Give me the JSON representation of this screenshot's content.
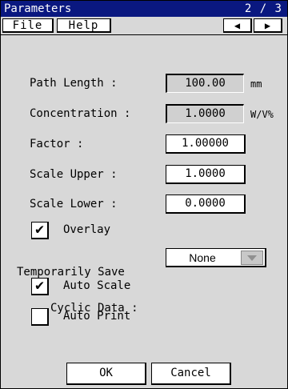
{
  "window": {
    "title": "Parameters",
    "page_indicator": "2 / 3"
  },
  "menu": {
    "file": "File",
    "help": "Help",
    "prev_icon": "left-arrow",
    "next_icon": "right-arrow"
  },
  "fields": {
    "path_length": {
      "label": "Path Length :",
      "value": "100.00",
      "unit": "mm"
    },
    "concentration": {
      "label": "Concentration :",
      "value": "1.0000",
      "unit": "W/V%"
    },
    "factor": {
      "label": "Factor :",
      "value": "1.00000"
    },
    "scale_upper": {
      "label": "Scale Upper :",
      "value": "1.0000"
    },
    "scale_lower": {
      "label": "Scale Lower :",
      "value": "0.0000"
    }
  },
  "checkboxes": {
    "overlay": {
      "label": "Overlay",
      "checked": true
    },
    "auto_scale": {
      "label": "Auto Scale",
      "checked": true
    },
    "auto_print": {
      "label": "Auto Print",
      "checked": false
    }
  },
  "cyclic": {
    "label_line1": "Temporarily Save",
    "label_line2": "Cyclic Data :",
    "selected": "None"
  },
  "buttons": {
    "ok": "OK",
    "cancel": "Cancel"
  },
  "check_mark": "✔"
}
